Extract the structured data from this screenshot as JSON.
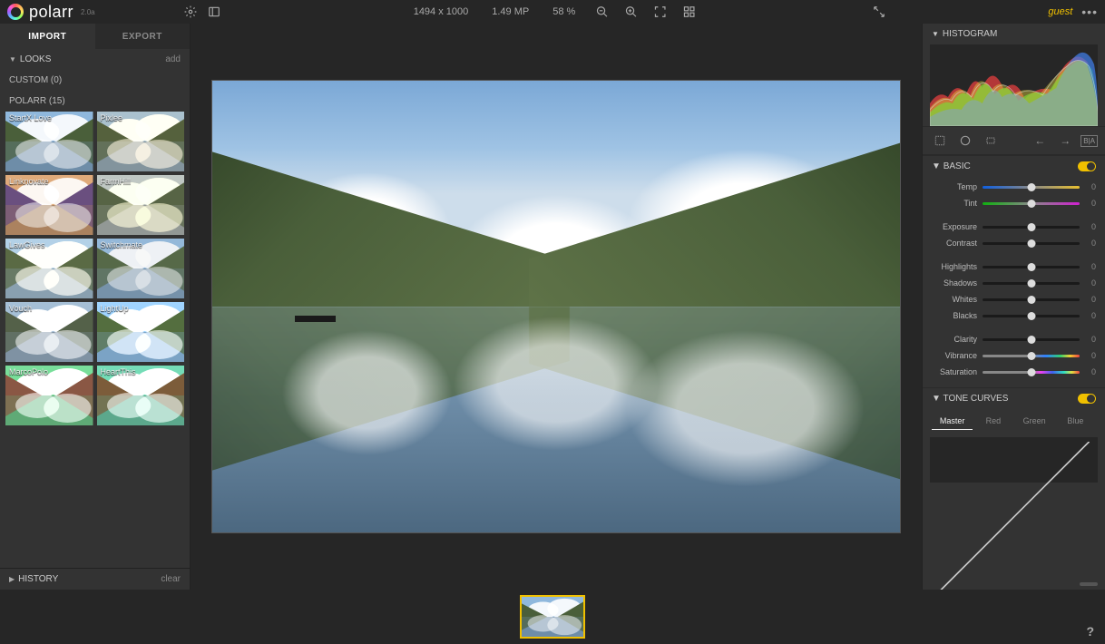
{
  "app": {
    "name": "polarr",
    "subtitle": "2.0a"
  },
  "topbar": {
    "dimensions": "1494 x 1000",
    "megapixels": "1.49 MP",
    "zoom": "58 %",
    "user": "guest"
  },
  "tabs": {
    "import": "IMPORT",
    "export": "EXPORT",
    "active": "import"
  },
  "looks": {
    "title": "LOOKS",
    "add": "add",
    "custom_header": "CUSTOM (0)",
    "polarr_header": "POLARR (15)",
    "items": [
      {
        "label": "StartX Love"
      },
      {
        "label": "Pixlee"
      },
      {
        "label": "Linknovate"
      },
      {
        "label": "FarmHill"
      },
      {
        "label": "LawGives"
      },
      {
        "label": "Switchmate"
      },
      {
        "label": "Vouch"
      },
      {
        "label": "LightUp"
      },
      {
        "label": "MarcoPolo"
      },
      {
        "label": "HeartThis"
      }
    ]
  },
  "history": {
    "title": "HISTORY",
    "clear": "clear"
  },
  "right": {
    "histogram": "HISTOGRAM",
    "basic": {
      "title": "BASIC",
      "sliders": [
        {
          "label": "Temp",
          "value": 0,
          "gradient": "temp"
        },
        {
          "label": "Tint",
          "value": 0,
          "gradient": "tint"
        }
      ],
      "sliders2": [
        {
          "label": "Exposure",
          "value": 0
        },
        {
          "label": "Contrast",
          "value": 0
        }
      ],
      "sliders3": [
        {
          "label": "Highlights",
          "value": 0
        },
        {
          "label": "Shadows",
          "value": 0
        },
        {
          "label": "Whites",
          "value": 0
        },
        {
          "label": "Blacks",
          "value": 0
        }
      ],
      "sliders4": [
        {
          "label": "Clarity",
          "value": 0
        },
        {
          "label": "Vibrance",
          "value": 0,
          "gradient": "vib"
        },
        {
          "label": "Saturation",
          "value": 0,
          "gradient": "sat"
        }
      ]
    },
    "tonecurves": {
      "title": "TONE CURVES",
      "tabs": [
        "Master",
        "Red",
        "Green",
        "Blue"
      ],
      "active": 0
    },
    "ba_label": "B|A"
  },
  "icons": {
    "gear": "gear-icon",
    "panels": "panels-icon",
    "zoom_out": "zoom-out-icon",
    "zoom_in": "zoom-in-icon",
    "fit": "fit-icon",
    "grid": "grid-icon",
    "expand": "expand-icon",
    "more": "more-icon",
    "crop": "crop-icon",
    "circle": "circle-mask-icon",
    "rect": "rect-mask-icon",
    "undo": "undo-icon",
    "redo": "redo-icon",
    "compare": "compare-icon",
    "help": "help-icon"
  }
}
